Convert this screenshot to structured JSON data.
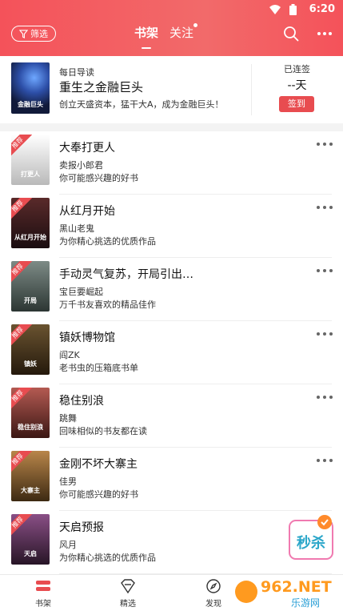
{
  "status": {
    "time": "6:20"
  },
  "header": {
    "filter_label": "筛选",
    "tabs": [
      {
        "label": "书架"
      },
      {
        "label": "关注"
      }
    ]
  },
  "daily": {
    "label": "每日导读",
    "title": "重生之金融巨头",
    "description": "创立天盛资本，猛干大A，成为金融巨头！",
    "cover_text": "金融巨头",
    "signed_label": "已连签",
    "signed_days": "--天",
    "checkin_label": "签到"
  },
  "books": [
    {
      "title": "大奉打更人",
      "author": "卖报小郎君",
      "desc": "你可能感兴趣的好书",
      "badge": "推荐",
      "cover_text": "打更人",
      "colors": [
        "#ffffff",
        "#b9b9b9"
      ]
    },
    {
      "title": "从红月开始",
      "author": "黑山老鬼",
      "desc": "为你精心挑选的优质作品",
      "badge": "推荐",
      "cover_text": "从红月开始",
      "colors": [
        "#5a2a2a",
        "#1a0d10"
      ]
    },
    {
      "title": "手动灵气复苏，开局引出…",
      "author": "宝巨要崛起",
      "desc": "万千书友喜欢的精品佳作",
      "badge": "推荐",
      "cover_text": "开局",
      "colors": [
        "#7d8b86",
        "#2c3633"
      ]
    },
    {
      "title": "镇妖博物馆",
      "author": "阎ZK",
      "desc": "老书虫的压箱底书单",
      "badge": "推荐",
      "cover_text": "镇妖",
      "colors": [
        "#6a5330",
        "#24190c"
      ]
    },
    {
      "title": "稳住别浪",
      "author": "跳舞",
      "desc": "回味相似的书友都在读",
      "badge": "推荐",
      "cover_text": "稳住别浪",
      "colors": [
        "#b45a52",
        "#3b1714"
      ]
    },
    {
      "title": "金刚不坏大寨主",
      "author": "佳男",
      "desc": "你可能感兴趣的好书",
      "badge": "推荐",
      "cover_text": "大寨主",
      "colors": [
        "#b9864a",
        "#3d2a12"
      ]
    },
    {
      "title": "天启预报",
      "author": "风月",
      "desc": "为你精心挑选的优质作品",
      "badge": "推荐",
      "cover_text": "天启",
      "colors": [
        "#8a4f86",
        "#271526"
      ]
    }
  ],
  "promo": {
    "label": "秒杀"
  },
  "bottom_nav": [
    {
      "label": "书架"
    },
    {
      "label": "精选"
    },
    {
      "label": "发现"
    }
  ],
  "watermark": {
    "text": "962.NET",
    "subtext": "乐游网"
  },
  "colors": {
    "accent": "#f4525a",
    "checkin": "#e84c50"
  }
}
